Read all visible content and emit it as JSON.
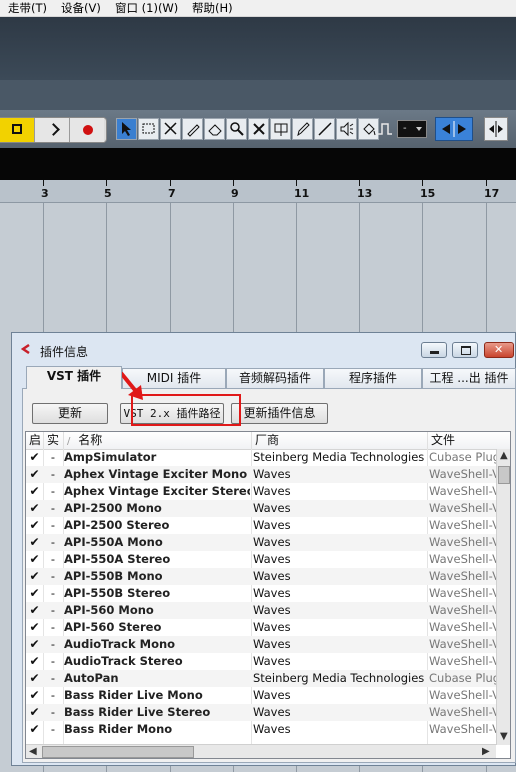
{
  "menu": [
    "走带(T)",
    "设备(V)",
    "窗口 (1)(W)",
    "帮助(H)"
  ],
  "toolbar": {
    "snap_value": "-"
  },
  "ruler": {
    "marks": [
      "3",
      "5",
      "7",
      "9",
      "11",
      "13",
      "15",
      "17"
    ]
  },
  "window": {
    "title": "插件信息",
    "tabs": [
      "VST 插件",
      "MIDI 插件",
      "音频解码插件",
      "程序插件",
      "工程 ...出 插件"
    ],
    "buttons": {
      "refresh": "更新",
      "vst2_path": "VST 2.x 插件路径",
      "update_info": "更新插件信息"
    },
    "columns": {
      "enabled": "启",
      "instance": "实",
      "sort": "/",
      "name": "名称",
      "vendor": "厂商",
      "file": "文件"
    },
    "rows": [
      {
        "check": "✔",
        "dash": "-",
        "name": "AmpSimulator",
        "vendor": "Steinberg Media Technologies",
        "file": "Cubase Plug-ins"
      },
      {
        "check": "✔",
        "dash": "-",
        "name": "Aphex Vintage Exciter Mono",
        "vendor": "Waves",
        "file": "WaveShell-VST"
      },
      {
        "check": "✔",
        "dash": "-",
        "name": "Aphex Vintage Exciter Stereo",
        "vendor": "Waves",
        "file": "WaveShell-VST"
      },
      {
        "check": "✔",
        "dash": "-",
        "name": "API-2500 Mono",
        "vendor": "Waves",
        "file": "WaveShell-VST"
      },
      {
        "check": "✔",
        "dash": "-",
        "name": "API-2500 Stereo",
        "vendor": "Waves",
        "file": "WaveShell-VST"
      },
      {
        "check": "✔",
        "dash": "-",
        "name": "API-550A Mono",
        "vendor": "Waves",
        "file": "WaveShell-VST"
      },
      {
        "check": "✔",
        "dash": "-",
        "name": "API-550A Stereo",
        "vendor": "Waves",
        "file": "WaveShell-VST"
      },
      {
        "check": "✔",
        "dash": "-",
        "name": "API-550B Mono",
        "vendor": "Waves",
        "file": "WaveShell-VST"
      },
      {
        "check": "✔",
        "dash": "-",
        "name": "API-550B Stereo",
        "vendor": "Waves",
        "file": "WaveShell-VST"
      },
      {
        "check": "✔",
        "dash": "-",
        "name": "API-560 Mono",
        "vendor": "Waves",
        "file": "WaveShell-VST"
      },
      {
        "check": "✔",
        "dash": "-",
        "name": "API-560 Stereo",
        "vendor": "Waves",
        "file": "WaveShell-VST"
      },
      {
        "check": "✔",
        "dash": "-",
        "name": "AudioTrack Mono",
        "vendor": "Waves",
        "file": "WaveShell-VST"
      },
      {
        "check": "✔",
        "dash": "-",
        "name": "AudioTrack Stereo",
        "vendor": "Waves",
        "file": "WaveShell-VST"
      },
      {
        "check": "✔",
        "dash": "-",
        "name": "AutoPan",
        "vendor": "Steinberg Media Technologies",
        "file": "Cubase Plug-ins"
      },
      {
        "check": "✔",
        "dash": "-",
        "name": "Bass Rider Live Mono",
        "vendor": "Waves",
        "file": "WaveShell-VST"
      },
      {
        "check": "✔",
        "dash": "-",
        "name": "Bass Rider Live Stereo",
        "vendor": "Waves",
        "file": "WaveShell-VST"
      },
      {
        "check": "✔",
        "dash": "-",
        "name": "Bass Rider Mono",
        "vendor": "Waves",
        "file": "WaveShell-VST"
      }
    ]
  },
  "colors": {
    "highlight_box": "#e01818",
    "accent_blue": "#3a82d8",
    "stop_yellow": "#f2d200"
  }
}
